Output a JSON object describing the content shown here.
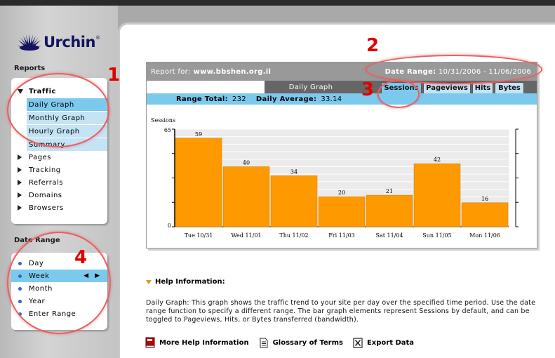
{
  "logo": {
    "text": "Urchin",
    "tm": "®"
  },
  "sidebar": {
    "reports_title": "Reports",
    "traffic": {
      "label": "Traffic",
      "items": [
        {
          "label": "Daily Graph",
          "active": true
        },
        {
          "label": "Monthly Graph",
          "active": false
        },
        {
          "label": "Hourly Graph",
          "active": false
        },
        {
          "label": "Summary",
          "active": false
        }
      ]
    },
    "sections": [
      {
        "label": "Pages"
      },
      {
        "label": "Tracking"
      },
      {
        "label": "Referrals"
      },
      {
        "label": "Domains"
      },
      {
        "label": "Browsers"
      }
    ],
    "date_range_title": "Date Range",
    "date_range_items": [
      {
        "label": "Day",
        "active": false
      },
      {
        "label": "Week",
        "active": true
      },
      {
        "label": "Month",
        "active": false
      },
      {
        "label": "Year",
        "active": false
      },
      {
        "label": "Enter Range",
        "active": false
      }
    ],
    "week_arrows": "◀ ▶"
  },
  "report": {
    "report_for_label": "Report for:",
    "site": "www.bbshen.org.il",
    "date_range_label": "Date Range:",
    "date_range_value": "10/31/2006 - 11/06/2006",
    "graph_title": "Daily Graph",
    "tabs": [
      {
        "label": "Sessions",
        "active": true
      },
      {
        "label": "Pageviews",
        "active": false
      },
      {
        "label": "Hits",
        "active": false
      },
      {
        "label": "Bytes",
        "active": false
      }
    ],
    "range_total_label": "Range Total:",
    "range_total_value": "232",
    "daily_average_label": "Daily Average:",
    "daily_average_value": "33.14"
  },
  "chart_data": {
    "type": "bar",
    "ylabel": "Sessions",
    "ylim": [
      0,
      65
    ],
    "yticks": [
      "65",
      "0"
    ],
    "categories": [
      "Tue 10/31",
      "Wed 11/01",
      "Thu 11/02",
      "Fri 11/03",
      "Sat 11/04",
      "Sun 11/05",
      "Mon 11/06"
    ],
    "values": [
      59,
      40,
      34,
      20,
      21,
      42,
      16
    ],
    "bar_color": "#ff9900",
    "grid": true
  },
  "help": {
    "title": "Help Information:",
    "text": "Daily Graph: This graph shows the traffic trend to your site per day over the specified time period. Use the date range function to specify a different range. The bar graph elements represent Sessions by default, and can be toggled to Pageviews, Hits, or Bytes transferred (bandwidth)."
  },
  "footer": {
    "more_help": "More Help Information",
    "glossary": "Glossary of Terms",
    "export": "Export Data"
  },
  "annotations": [
    "1",
    "2",
    "3",
    "4"
  ],
  "colors": {
    "accent": "#7cc9ee",
    "light": "#c4e3f5",
    "annotation": "#e00000"
  }
}
